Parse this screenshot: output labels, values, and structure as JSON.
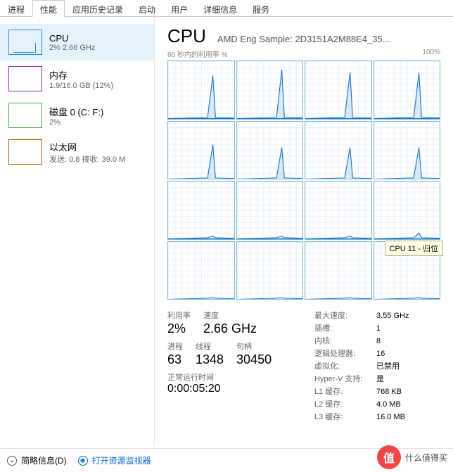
{
  "tabs": [
    "进程",
    "性能",
    "应用历史记录",
    "启动",
    "用户",
    "详细信息",
    "服务"
  ],
  "active_tab": 1,
  "sidebar": {
    "items": [
      {
        "title": "CPU",
        "sub": "2% 2.66 GHz"
      },
      {
        "title": "内存",
        "sub": "1.9/16.0 GB (12%)"
      },
      {
        "title": "磁盘 0 (C: F:)",
        "sub": "2%"
      },
      {
        "title": "以太网",
        "sub": "发送: 0.8 接收: 39.0 M"
      }
    ]
  },
  "header": {
    "title": "CPU",
    "model": "AMD Eng Sample: 2D3151A2M88E4_35..."
  },
  "chart": {
    "left_label": "60 秒内的利用率 %",
    "right_label": "100%",
    "tooltip": "CPU 11 - 归位",
    "rows": 4,
    "cols": 4,
    "cells": [
      {
        "spike": 0.75
      },
      {
        "spike": 0.85
      },
      {
        "spike": 0.8
      },
      {
        "spike": 0.8
      },
      {
        "spike": 0.6
      },
      {
        "spike": 0.55
      },
      {
        "spike": 0.55
      },
      {
        "spike": 0.55
      },
      {
        "spike": 0.05
      },
      {
        "spike": 0.05
      },
      {
        "spike": 0.05
      },
      {
        "spike": 0.1
      },
      {
        "spike": 0.03
      },
      {
        "spike": 0.03
      },
      {
        "spike": 0.03
      },
      {
        "spike": 0.03
      }
    ]
  },
  "stats_left": {
    "row1": [
      {
        "label": "利用率",
        "value": "2%"
      },
      {
        "label": "速度",
        "value": "2.66 GHz"
      }
    ],
    "row2": [
      {
        "label": "进程",
        "value": "63"
      },
      {
        "label": "线程",
        "value": "1348"
      },
      {
        "label": "句柄",
        "value": "30450"
      }
    ],
    "uptime_label": "正常运行时间",
    "uptime_value": "0:00:05:20"
  },
  "stats_right": [
    {
      "k": "最大速度:",
      "v": "3.55 GHz"
    },
    {
      "k": "插槽:",
      "v": "1"
    },
    {
      "k": "内核:",
      "v": "8"
    },
    {
      "k": "逻辑处理器:",
      "v": "16"
    },
    {
      "k": "虚拟化:",
      "v": "已禁用"
    },
    {
      "k": "Hyper-V 支持:",
      "v": "是"
    },
    {
      "k": "L1 缓存:",
      "v": "768 KB"
    },
    {
      "k": "L2 缓存:",
      "v": "4.0 MB"
    },
    {
      "k": "L3 缓存:",
      "v": "16.0 MB"
    }
  ],
  "footer": {
    "brief": "简略信息(D)",
    "monitor": "打开资源监视器"
  },
  "watermark": {
    "symbol": "值",
    "text": "什么值得买"
  },
  "chart_data": {
    "type": "line",
    "title": "60 秒内的利用率 %",
    "ylim": [
      0,
      100
    ],
    "xrange_seconds": 60,
    "series_count": 16,
    "series_description": "per-logical-processor utilization, each cell shows one CPU; top two rows show a single sharp spike near ~60–85%, bottom two rows stay near 0–10%",
    "approx_peak_percent_per_cell": [
      75,
      85,
      80,
      80,
      60,
      55,
      55,
      55,
      5,
      5,
      5,
      10,
      3,
      3,
      3,
      3
    ]
  }
}
